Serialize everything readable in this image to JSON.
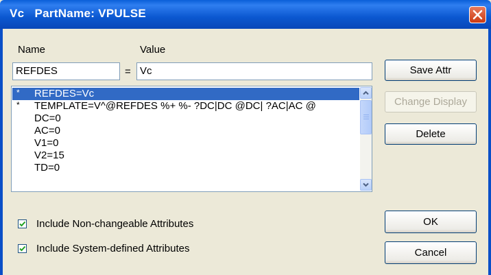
{
  "window": {
    "title": "Vc   PartName: VPULSE"
  },
  "labels": {
    "name": "Name",
    "value": "Value",
    "equals": "="
  },
  "fields": {
    "name_value": "REFDES",
    "value_value": "Vc"
  },
  "attributes": [
    {
      "star": "*",
      "text": "REFDES=Vc",
      "selected": true
    },
    {
      "star": "*",
      "text": "TEMPLATE=V^@REFDES %+ %- ?DC|DC @DC| ?AC|AC @",
      "selected": false
    },
    {
      "star": "",
      "text": "DC=0",
      "selected": false
    },
    {
      "star": "",
      "text": "AC=0",
      "selected": false
    },
    {
      "star": "",
      "text": "V1=0",
      "selected": false
    },
    {
      "star": "",
      "text": "V2=15",
      "selected": false
    },
    {
      "star": "",
      "text": "TD=0",
      "selected": false
    }
  ],
  "buttons": {
    "save_attr": "Save Attr",
    "change_display": "Change Display",
    "delete": "Delete",
    "ok": "OK",
    "cancel": "Cancel"
  },
  "checkboxes": {
    "non_changeable": {
      "label": "Include Non-changeable Attributes",
      "checked": true
    },
    "system_defined": {
      "label": "Include System-defined Attributes",
      "checked": true
    }
  },
  "colors": {
    "title_bar": "#0a5fd8",
    "selection": "#316ac5",
    "dialog_bg": "#ece9d8"
  }
}
